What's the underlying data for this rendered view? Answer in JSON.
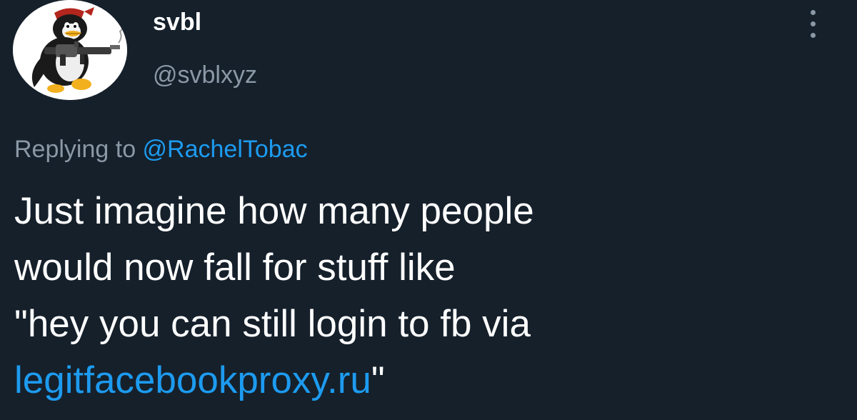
{
  "tweet": {
    "author": {
      "display_name": "svbl",
      "handle": "@svblxyz",
      "avatar_icon": "penguin-with-gun-avatar"
    },
    "more_icon": "vertical-ellipsis-icon",
    "reply": {
      "prefix": "Replying to ",
      "mention": "@RachelTobac"
    },
    "text_lines": [
      "Just imagine how many people",
      "would now fall for stuff like",
      "\"hey you can still login to fb via"
    ],
    "link": {
      "text": "legitfacebookproxy.ru",
      "suffix": "\""
    }
  },
  "colors": {
    "background": "#15202b",
    "primary_text": "#ffffff",
    "secondary_text": "#8b98a5",
    "link": "#1d9bf0"
  }
}
